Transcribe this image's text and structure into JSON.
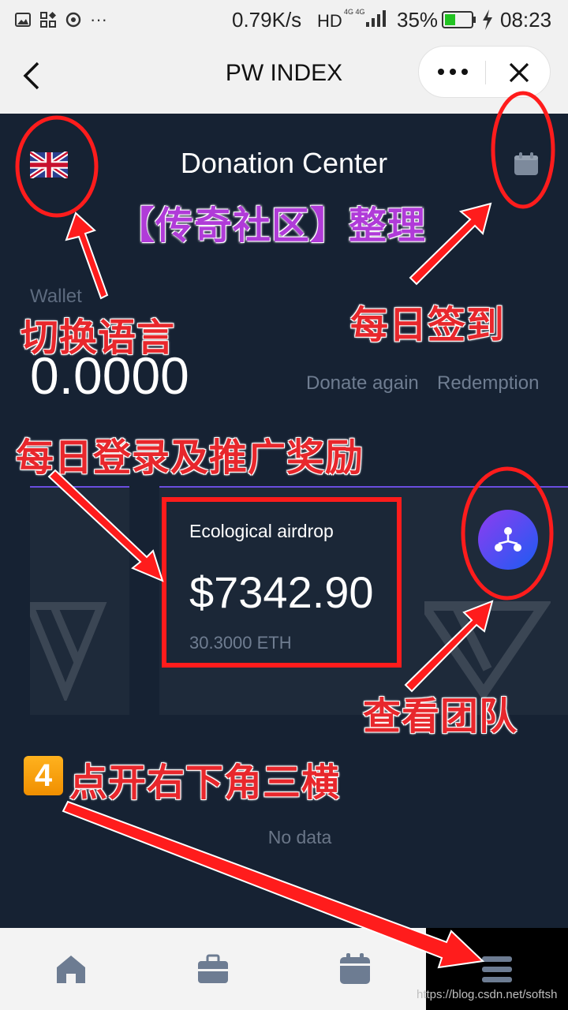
{
  "status_bar": {
    "speed": "0.79K/s",
    "network": "HD",
    "network_sub": "4G 4G",
    "battery": "35%",
    "time": "08:23",
    "more": "···"
  },
  "nav": {
    "title": "PW INDEX"
  },
  "page": {
    "title": "Donation Center",
    "wallet_label": "Wallet",
    "wallet_value": "0.0000",
    "donate_again": "Donate again",
    "redemption": "Redemption"
  },
  "card": {
    "label": "Ecological airdrop",
    "value": "$7342.90",
    "eth": "30.3000 ETH"
  },
  "list": {
    "empty": "No data"
  },
  "annotations": {
    "banner": "【传奇社区】整理",
    "switch_language": "切换语言",
    "daily_checkin": "每日签到",
    "daily_reward": "每日登录及推广奖励",
    "view_team": "查看团队",
    "step_number": "4",
    "open_menu": "点开右下角三横"
  },
  "footer": {
    "watermark_url": "https://blog.csdn.net/softsh"
  },
  "colors": {
    "background": "#162233",
    "annotation_red": "#e8272c",
    "annotation_purple": "#b03bd8",
    "accent": "#6a4de0"
  }
}
